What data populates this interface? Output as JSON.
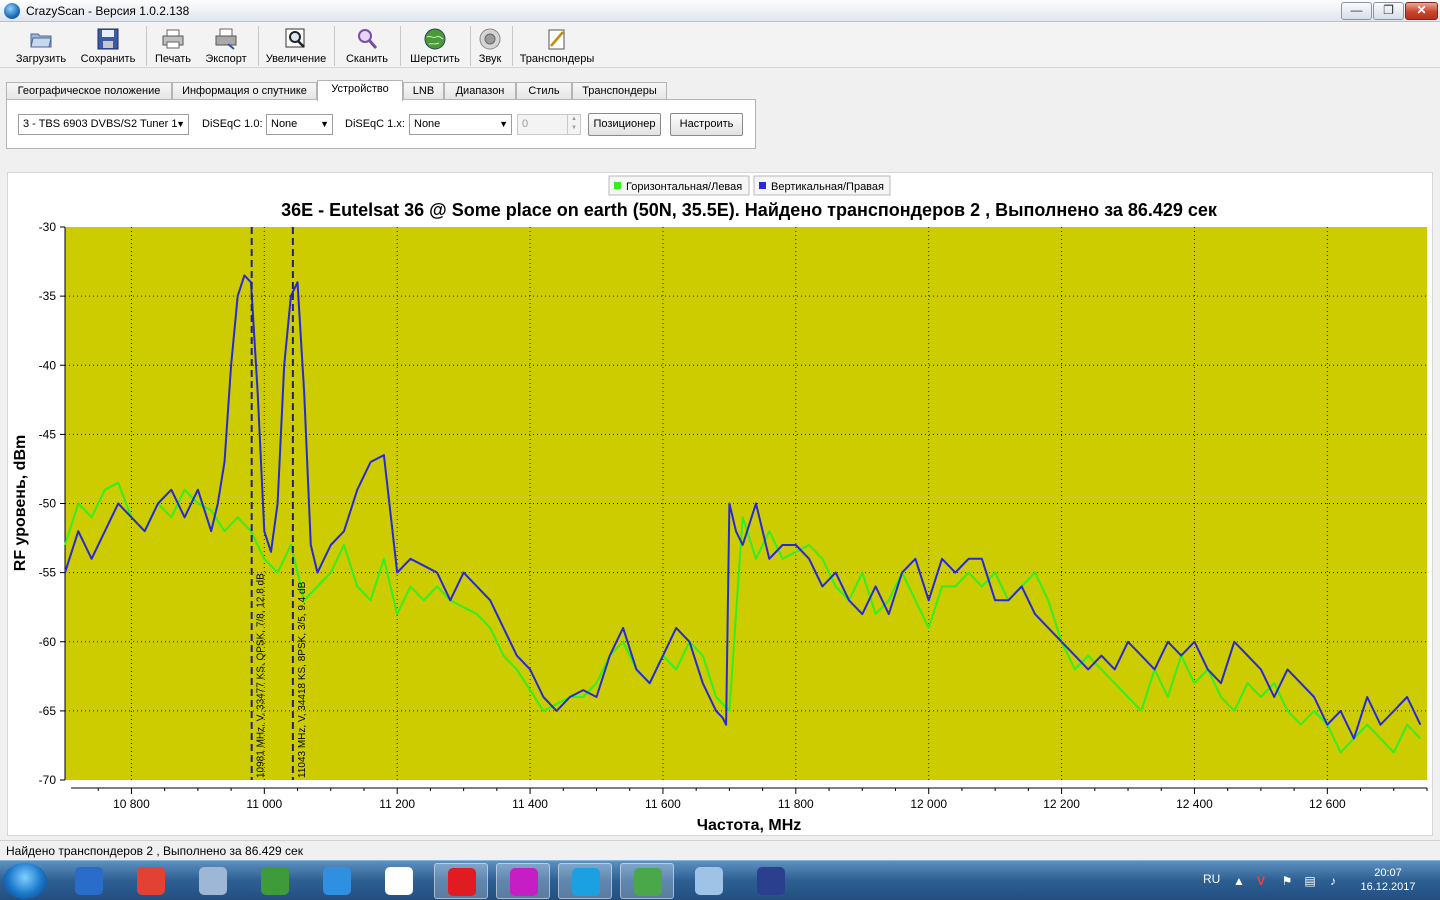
{
  "window": {
    "title": "CrazyScan - Версия 1.0.2.138"
  },
  "toolbar": [
    {
      "name": "load-button",
      "label": "Загрузить",
      "icon": "folder-icon"
    },
    {
      "name": "save-button",
      "label": "Сохранить",
      "icon": "floppy-icon"
    },
    {
      "name": "print-button",
      "label": "Печать",
      "icon": "printer-icon"
    },
    {
      "name": "export-button",
      "label": "Экспорт",
      "icon": "export-printer-icon"
    },
    {
      "name": "zoom-button",
      "label": "Увеличение",
      "icon": "zoom-icon"
    },
    {
      "name": "scan-button",
      "label": "Сканить",
      "icon": "magnifier-icon"
    },
    {
      "name": "blindscan-button",
      "label": "Шерстить",
      "icon": "globe-icon"
    },
    {
      "name": "sound-button",
      "label": "Звук",
      "icon": "speaker-icon"
    },
    {
      "name": "transponders-button",
      "label": "Транспондеры",
      "icon": "notepad-icon"
    }
  ],
  "tabs": [
    "Географическое положение",
    "Информация о спутнике",
    "Устройство",
    "LNB",
    "Диапазон",
    "Стиль",
    "Транспондеры"
  ],
  "active_tab": "Устройство",
  "device": {
    "tuner": "3 - TBS 6903 DVBS/S2 Tuner 1",
    "diseqc10_label": "DiSEqC 1.0:",
    "diseqc10_value": "None",
    "diseqc1x_label": "DiSEqC 1.x:",
    "diseqc1x_value": "None",
    "spin_value": "0",
    "positioner_label": "Позиционер",
    "configure_label": "Настроить"
  },
  "chart_data": {
    "type": "line",
    "title": "36E - Eutelsat 36 @ Some place on earth (50N, 35.5E). Найдено транспондеров 2 , Выполнено за 86.429 сек",
    "xlabel": "Частота, MHz",
    "ylabel": "RF уровень, dBm",
    "xlim": [
      10700,
      12750
    ],
    "ylim": [
      -70,
      -30
    ],
    "xticks": [
      10800,
      11000,
      11200,
      11400,
      11600,
      11800,
      12000,
      12200,
      12400,
      12600
    ],
    "xtick_labels": [
      "10 800",
      "11 000",
      "11 200",
      "11 400",
      "11 600",
      "11 800",
      "12 000",
      "12 200",
      "12 400",
      "12 600"
    ],
    "yticks": [
      -30,
      -35,
      -40,
      -45,
      -50,
      -55,
      -60,
      -65,
      -70
    ],
    "grid": true,
    "background_color": "#cccc00",
    "legend_position": "top",
    "series": [
      {
        "name": "Горизонтальная/Левая",
        "color": "#33ee22",
        "x": [
          10700,
          10720,
          10740,
          10760,
          10780,
          10800,
          10820,
          10840,
          10860,
          10880,
          10900,
          10920,
          10940,
          10960,
          10980,
          11000,
          11020,
          11040,
          11060,
          11080,
          11100,
          11120,
          11140,
          11160,
          11180,
          11200,
          11220,
          11240,
          11260,
          11280,
          11300,
          11320,
          11340,
          11360,
          11380,
          11400,
          11420,
          11440,
          11460,
          11480,
          11500,
          11520,
          11540,
          11560,
          11580,
          11600,
          11620,
          11640,
          11660,
          11680,
          11700,
          11720,
          11740,
          11760,
          11780,
          11800,
          11820,
          11840,
          11860,
          11880,
          11900,
          11920,
          11940,
          11960,
          11980,
          12000,
          12020,
          12040,
          12060,
          12080,
          12100,
          12120,
          12140,
          12160,
          12180,
          12200,
          12220,
          12240,
          12260,
          12280,
          12300,
          12320,
          12340,
          12360,
          12380,
          12400,
          12420,
          12440,
          12460,
          12480,
          12500,
          12520,
          12540,
          12560,
          12580,
          12600,
          12620,
          12640,
          12660,
          12680,
          12700,
          12720,
          12740
        ],
        "y": [
          -53,
          -50,
          -51,
          -49,
          -48.5,
          -51,
          -52,
          -50,
          -51,
          -49,
          -50,
          -50.5,
          -52,
          -51,
          -52,
          -54,
          -55,
          -53,
          -57,
          -56,
          -55,
          -53,
          -56,
          -57,
          -54,
          -58,
          -56,
          -57,
          -56,
          -57,
          -57.5,
          -58,
          -59,
          -61,
          -62,
          -63.5,
          -65,
          -64.5,
          -64,
          -64,
          -63,
          -61,
          -60,
          -62,
          -63,
          -61,
          -62,
          -60,
          -61,
          -64,
          -65,
          -51,
          -54,
          -52,
          -54,
          -53.5,
          -53,
          -54,
          -56,
          -57,
          -55,
          -58,
          -57,
          -55,
          -57,
          -59,
          -56,
          -56,
          -55,
          -56,
          -55,
          -57,
          -56,
          -55,
          -57,
          -60,
          -62,
          -61,
          -62,
          -63,
          -64,
          -65,
          -62,
          -64,
          -61,
          -63,
          -62,
          -64,
          -65,
          -63,
          -64,
          -63,
          -65,
          -66,
          -65,
          -66,
          -68,
          -67,
          -66,
          -67,
          -68,
          -66,
          -67
        ]
      },
      {
        "name": "Вертикальная/Правая",
        "color": "#2828d8",
        "x": [
          10700,
          10720,
          10740,
          10760,
          10780,
          10800,
          10820,
          10840,
          10860,
          10880,
          10900,
          10920,
          10930,
          10940,
          10950,
          10960,
          10970,
          10980,
          10990,
          11000,
          11010,
          11020,
          11030,
          11040,
          11050,
          11060,
          11070,
          11080,
          11100,
          11120,
          11140,
          11160,
          11180,
          11200,
          11220,
          11240,
          11260,
          11280,
          11300,
          11320,
          11340,
          11360,
          11380,
          11400,
          11420,
          11440,
          11460,
          11480,
          11500,
          11520,
          11540,
          11560,
          11580,
          11600,
          11620,
          11640,
          11660,
          11680,
          11690,
          11695,
          11700,
          11710,
          11720,
          11740,
          11760,
          11780,
          11800,
          11820,
          11840,
          11860,
          11880,
          11900,
          11920,
          11940,
          11960,
          11980,
          12000,
          12020,
          12040,
          12060,
          12080,
          12100,
          12120,
          12140,
          12160,
          12180,
          12200,
          12220,
          12240,
          12260,
          12280,
          12300,
          12320,
          12340,
          12360,
          12380,
          12400,
          12420,
          12440,
          12460,
          12480,
          12500,
          12520,
          12540,
          12560,
          12580,
          12600,
          12620,
          12640,
          12660,
          12680,
          12700,
          12720,
          12740
        ],
        "y": [
          -55,
          -52,
          -54,
          -52,
          -50,
          -51,
          -52,
          -50,
          -49,
          -51,
          -49,
          -52,
          -50,
          -47,
          -40,
          -35,
          -33.5,
          -34,
          -42,
          -52,
          -53.5,
          -50,
          -40,
          -35,
          -34,
          -42,
          -53,
          -55,
          -53,
          -52,
          -49,
          -47,
          -46.5,
          -55,
          -54,
          -54.5,
          -55,
          -57,
          -55,
          -56,
          -57,
          -59,
          -61,
          -62,
          -64,
          -65,
          -64,
          -63.5,
          -64,
          -61,
          -59,
          -62,
          -63,
          -61,
          -59,
          -60,
          -63,
          -65,
          -65.5,
          -66,
          -50,
          -52,
          -53,
          -50,
          -54,
          -53,
          -53,
          -54,
          -56,
          -55,
          -57,
          -58,
          -56,
          -58,
          -55,
          -54,
          -57,
          -54,
          -55,
          -54,
          -54,
          -57,
          -57,
          -56,
          -58,
          -59,
          -60,
          -61,
          -62,
          -61,
          -62,
          -60,
          -61,
          -62,
          -60,
          -61,
          -60,
          -62,
          -63,
          -60,
          -61,
          -62,
          -64,
          -62,
          -63,
          -64,
          -66,
          -65,
          -67,
          -64,
          -66,
          -65,
          -64,
          -66
        ]
      }
    ],
    "markers": [
      {
        "x": 10981,
        "label": "10981 MHz, V, 33477 KS, QPSK, 7/8, 12.8 dB"
      },
      {
        "x": 11043,
        "label": "11043 MHz, V, 34418 KS, 8PSK, 3/5, 9.4 dB"
      }
    ]
  },
  "status": {
    "text": "Найдено транспондеров 2 , Выполнено за 86.429 сек"
  },
  "taskbar": {
    "items": [
      {
        "name": "taskbar-car-icon",
        "color": "#2a6cc9",
        "active": false
      },
      {
        "name": "taskbar-chrome-icon",
        "color": "#e34133",
        "active": false
      },
      {
        "name": "taskbar-calculator-icon",
        "color": "#9fb7d6",
        "active": false
      },
      {
        "name": "taskbar-globe-icon",
        "color": "#3f9a3a",
        "active": false
      },
      {
        "name": "taskbar-ie-icon",
        "color": "#2f8fe0",
        "active": false
      },
      {
        "name": "taskbar-yandex-icon",
        "color": "#ffffff",
        "active": false
      },
      {
        "name": "taskbar-opera-icon",
        "color": "#e01b22",
        "active": true
      },
      {
        "name": "taskbar-colorbox-icon",
        "color": "#c41ec4",
        "active": true
      },
      {
        "name": "taskbar-skype-icon",
        "color": "#1ba1e2",
        "active": true
      },
      {
        "name": "taskbar-crazyscan-icon",
        "color": "#4aa84a",
        "active": true
      },
      {
        "name": "taskbar-network-icon",
        "color": "#9fc3e6",
        "active": false
      },
      {
        "name": "taskbar-floppy-icon",
        "color": "#2b3f8f",
        "active": false
      }
    ],
    "lang": "RU",
    "time": "20:07",
    "date": "16.12.2017"
  }
}
